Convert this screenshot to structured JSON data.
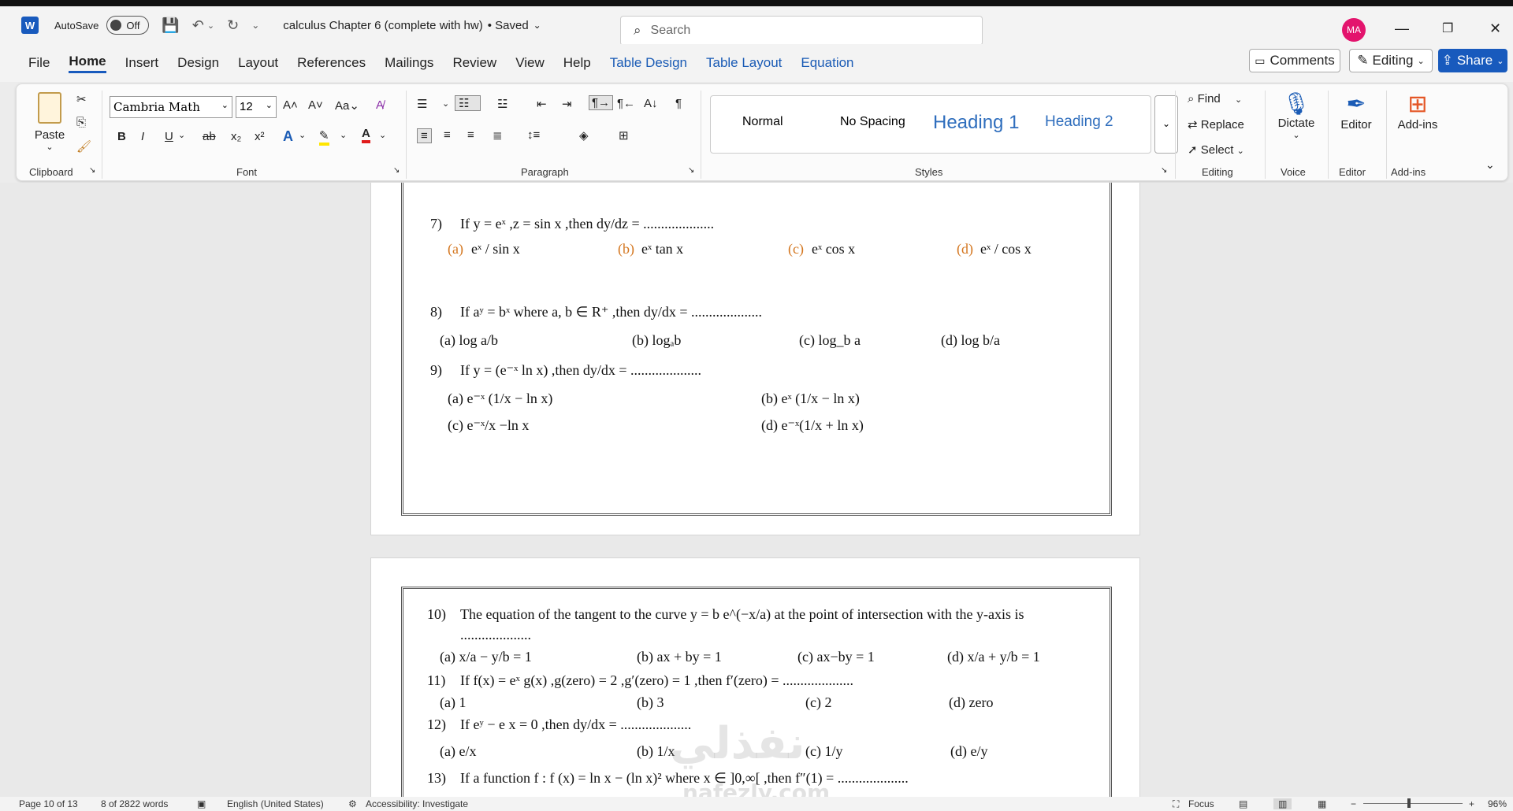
{
  "titlebar": {
    "autosave_label": "AutoSave",
    "autosave_state": "Off",
    "doc_title": "calculus Chapter 6 (complete with hw)",
    "save_status": "• Saved",
    "search_placeholder": "Search",
    "avatar_initials": "MA"
  },
  "menu": {
    "items": [
      "File",
      "Home",
      "Insert",
      "Design",
      "Layout",
      "References",
      "Mailings",
      "Review",
      "View",
      "Help",
      "Table Design",
      "Table Layout",
      "Equation"
    ],
    "active": "Home",
    "comments": "Comments",
    "editing": "Editing",
    "share": "Share"
  },
  "ribbon": {
    "clipboard": {
      "paste": "Paste",
      "label": "Clipboard"
    },
    "font": {
      "family": "Cambria Math",
      "size": "12",
      "label": "Font"
    },
    "paragraph": {
      "label": "Paragraph"
    },
    "styles": {
      "items": [
        "Normal",
        "No Spacing",
        "Heading 1",
        "Heading 2"
      ],
      "label": "Styles"
    },
    "editing": {
      "find": "Find",
      "replace": "Replace",
      "select": "Select",
      "label": "Editing"
    },
    "voice": {
      "dictate": "Dictate",
      "label": "Voice"
    },
    "editor": {
      "editor": "Editor",
      "label": "Editor"
    },
    "addins": {
      "addins": "Add-ins",
      "label": "Add-ins"
    }
  },
  "doc": {
    "q7": {
      "num": "7)",
      "text": "If y = eˣ ,z = sin x ,then dy/dz = ....................",
      "a": "(a)",
      "a_val": "eˣ / sin x",
      "b": "(b)",
      "b_val": "eˣ tan x",
      "c": "(c)",
      "c_val": "eˣ cos x",
      "d": "(d)",
      "d_val": "eˣ / cos x"
    },
    "q8": {
      "num": "8)",
      "text": "If aʸ = bˣ where a, b ∈ R⁺ ,then dy/dx = ....................",
      "a": "(a) log a/b",
      "b": "(b) logₐb",
      "c": "(c) log_b a",
      "d": "(d) log b/a"
    },
    "q9": {
      "num": "9)",
      "text": "If y = (e⁻ˣ ln x) ,then dy/dx = ....................",
      "a": "(a) e⁻ˣ (1/x − ln x)",
      "b": "(b) eˣ (1/x − ln x)",
      "c": "(c) e⁻ˣ/x −ln x",
      "d": "(d) e⁻ˣ(1/x + ln x)"
    },
    "q10": {
      "num": "10)",
      "text": "The equation of the tangent to the curve y = b e^(−x/a) at the point of intersection with the y-axis is",
      "dots": "....................",
      "a": "(a) x/a − y/b = 1",
      "b": "(b) ax + by = 1",
      "c": "(c) ax−by = 1",
      "d": "(d) x/a + y/b = 1"
    },
    "q11": {
      "num": "11)",
      "text": "If f(x) = eˣ g(x) ,g(zero) = 2 ,g′(zero) = 1 ,then f′(zero) = ....................",
      "a": "(a) 1",
      "b": "(b) 3",
      "c": "(c) 2",
      "d": "(d) zero"
    },
    "q12": {
      "num": "12)",
      "text": "If eʸ − e x = 0 ,then dy/dx = ....................",
      "a": "(a) e/x",
      "b": "(b) 1/x",
      "c": "(c) 1/y",
      "d": "(d) e/y"
    },
    "q13": {
      "num": "13)",
      "text": "If a function f : f (x) = ln x − (ln x)² where x ∈ ]0,∞[ ,then f″(1) = ...................."
    }
  },
  "status": {
    "page": "Page 10 of 13",
    "words": "8 of 2822 words",
    "language": "English (United States)",
    "accessibility": "Accessibility: Investigate",
    "focus": "Focus",
    "zoom": "96%"
  },
  "watermark": {
    "arabic": "نفذلي",
    "latin": "nafezly.com"
  },
  "colors": {
    "accent": "#185abd",
    "option_orange": "#d4761f",
    "avatar": "#e3146d"
  }
}
